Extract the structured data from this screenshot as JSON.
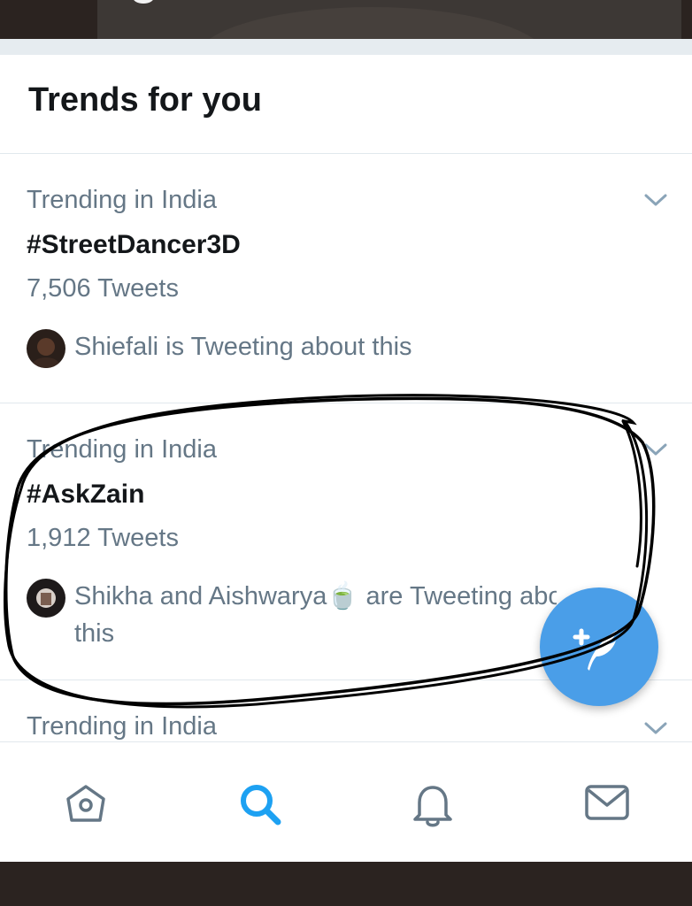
{
  "header": {
    "title": "Trends for you"
  },
  "trends": [
    {
      "context": "Trending in India",
      "tag": "#StreetDancer3D",
      "count": "7,506 Tweets",
      "social": "Shiefali is Tweeting about this"
    },
    {
      "context": "Trending in India",
      "tag": "#AskZain",
      "count": "1,912 Tweets",
      "social_line1": "Shikha and Aishwarya🍵 are Tweeting about",
      "social_line2": "this"
    },
    {
      "context": "Trending in India"
    }
  ],
  "tabbar": {
    "icons": [
      "home-icon",
      "search-icon",
      "notifications-icon",
      "messages-icon"
    ],
    "active": "search-icon"
  },
  "fab": {
    "icon": "compose-tweet-icon"
  },
  "colors": {
    "accent": "#1da1f2",
    "fab": "#4a9ee8",
    "secondary_text": "#657786",
    "primary_text": "#14171a",
    "annotation": "#000000"
  }
}
